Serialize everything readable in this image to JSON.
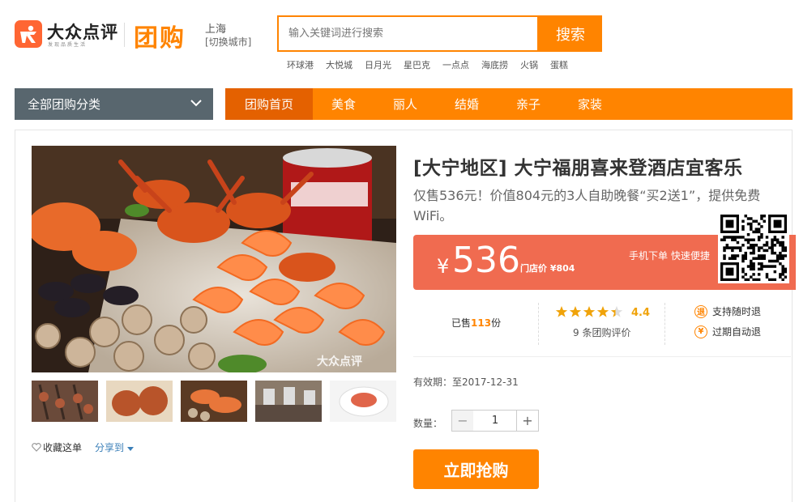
{
  "header": {
    "logo_text": "大众点评",
    "logo_slogan": "发现品质生活",
    "section_title": "团购",
    "city": "上海",
    "switch_city": "[切换城市]",
    "search_placeholder": "输入关键词进行搜索",
    "search_button": "搜索",
    "hot_words": [
      "环球港",
      "大悦城",
      "日月光",
      "星巴克",
      "一点点",
      "海底捞",
      "火锅",
      "蛋糕"
    ]
  },
  "nav": {
    "category_label": "全部团购分类",
    "items": [
      {
        "label": "团购首页",
        "active": true
      },
      {
        "label": "美食",
        "active": false
      },
      {
        "label": "丽人",
        "active": false
      },
      {
        "label": "结婚",
        "active": false
      },
      {
        "label": "亲子",
        "active": false
      },
      {
        "label": "家装",
        "active": false
      }
    ]
  },
  "deal": {
    "title": "[大宁地区] 大宁福朋喜来登酒店宜客乐",
    "description": "仅售536元！价值804元的3人自助晚餐“买2送1”，提供免费WiFi。",
    "price_symbol": "¥",
    "price": "536",
    "store_price": "门店价 ¥804",
    "mobile_tip": "手机下单 快速便捷",
    "sold_prefix": "已售",
    "sold_count": "113",
    "sold_suffix": "份",
    "rating": "4.4",
    "rating_value": 4.4,
    "reviews": "9 条团购评价",
    "guarantees": [
      "支持随时退",
      "过期自动退"
    ],
    "validity": "有效期：至2017-12-31",
    "quantity_label": "数量：",
    "quantity": "1",
    "buy_button": "立即抢购",
    "favorite": "收藏这单",
    "share": "分享到",
    "watermark": "大众点评"
  },
  "colors": {
    "brand_orange": "#ff8400",
    "nav_active": "#e46100",
    "price_red": "#f06b50",
    "category_gray": "#58666e",
    "star": "#f0a30a"
  },
  "icons": {
    "logo": "dianping-person-icon",
    "chevron": "chevron-down-icon",
    "heart": "heart-outline-icon",
    "qr": "qr-code",
    "guarantee_1": "refund-anytime-icon",
    "guarantee_2": "refund-expired-icon"
  }
}
